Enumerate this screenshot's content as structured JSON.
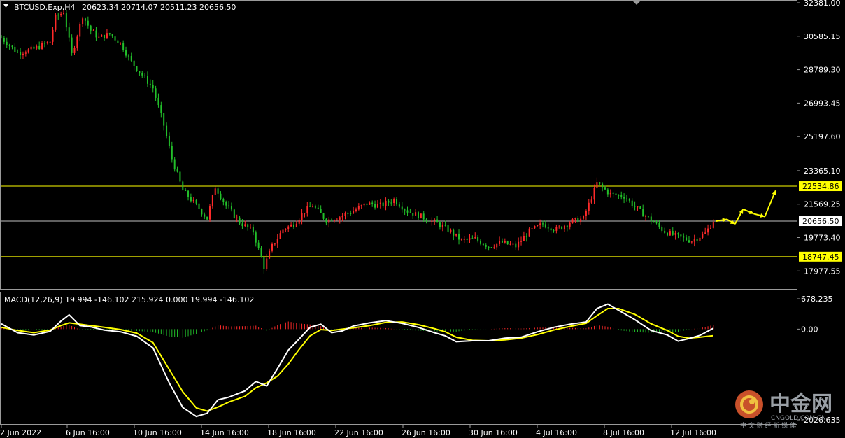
{
  "header": {
    "symbol": "BTCUSD.Exp,H4",
    "ohlc": "20623.34 20714.07 20511.23 20656.50"
  },
  "macd": {
    "label": "MACD(12,26,9) 19.994 -146.102 215.924 0.000 19.994 -146.102",
    "ticks": [
      "678.235",
      "0.00",
      "-2026.635"
    ]
  },
  "watermark": {
    "name": "中金网",
    "domain": "CNGOLD.COM.CN",
    "tagline": "中 文 财 经 新 媒 体"
  },
  "colors": {
    "background": "#000000",
    "bull_candle": "#ff2a2a",
    "bear_candle": "#22c02a",
    "level_line": "#ffff00",
    "current_line": "#c0c0c0",
    "macd_line": "#ffffff",
    "signal_line": "#ffff00",
    "arrow": "#ffff00"
  },
  "chart_data": [
    {
      "type": "candlestick",
      "title": "BTCUSD.Exp,H4",
      "ylim": [
        17200,
        32381
      ],
      "y_ticks": [
        "32381.00",
        "30585.15",
        "28789.30",
        "26993.45",
        "25197.60",
        "23365.10",
        "21569.25",
        "19773.40",
        "17977.55"
      ],
      "x_ticks": [
        "2 Jun 2022",
        "6 Jun 16:00",
        "10 Jun 16:00",
        "14 Jun 16:00",
        "18 Jun 16:00",
        "22 Jun 16:00",
        "26 Jun 16:00",
        "30 Jun 16:00",
        "4 Jul 16:00",
        "8 Jul 16:00",
        "12 Jul 16:00"
      ],
      "levels": [
        {
          "label": "22534.86",
          "value": 22534.86,
          "style": "yellow"
        },
        {
          "label": "20656.50",
          "value": 20656.5,
          "style": "current"
        },
        {
          "label": "18747.45",
          "value": 18747.45,
          "style": "yellow"
        }
      ],
      "price_path": [
        [
          0,
          30500
        ],
        [
          6,
          29700
        ],
        [
          12,
          29900
        ],
        [
          18,
          30300
        ],
        [
          20,
          31600
        ],
        [
          23,
          31900
        ],
        [
          26,
          29600
        ],
        [
          30,
          31700
        ],
        [
          33,
          30900
        ],
        [
          36,
          30500
        ],
        [
          40,
          30700
        ],
        [
          44,
          30200
        ],
        [
          48,
          29200
        ],
        [
          52,
          28500
        ],
        [
          56,
          27800
        ],
        [
          60,
          25800
        ],
        [
          63,
          24000
        ],
        [
          67,
          22300
        ],
        [
          72,
          21500
        ],
        [
          76,
          20800
        ],
        [
          79,
          22500
        ],
        [
          83,
          21500
        ],
        [
          88,
          20600
        ],
        [
          93,
          20100
        ],
        [
          97,
          18200
        ],
        [
          100,
          19300
        ],
        [
          104,
          20200
        ],
        [
          108,
          20500
        ],
        [
          112,
          21200
        ],
        [
          115,
          21500
        ],
        [
          120,
          20700
        ],
        [
          125,
          20900
        ],
        [
          130,
          21200
        ],
        [
          135,
          21600
        ],
        [
          140,
          21500
        ],
        [
          145,
          21800
        ],
        [
          150,
          21200
        ],
        [
          155,
          20900
        ],
        [
          160,
          20600
        ],
        [
          165,
          20200
        ],
        [
          170,
          19600
        ],
        [
          175,
          19700
        ],
        [
          180,
          19300
        ],
        [
          185,
          19500
        ],
        [
          190,
          19300
        ],
        [
          195,
          20100
        ],
        [
          200,
          20500
        ],
        [
          205,
          20200
        ],
        [
          210,
          20600
        ],
        [
          215,
          20800
        ],
        [
          220,
          22700
        ],
        [
          225,
          22100
        ],
        [
          230,
          22000
        ],
        [
          235,
          21300
        ],
        [
          240,
          20700
        ],
        [
          245,
          20100
        ],
        [
          250,
          19800
        ],
        [
          255,
          19600
        ],
        [
          260,
          20000
        ],
        [
          263,
          20656.5
        ]
      ],
      "projection": [
        [
          264,
          20656.5
        ],
        [
          268,
          20750
        ],
        [
          271,
          20500
        ],
        [
          274,
          21300
        ],
        [
          278,
          21050
        ],
        [
          282,
          20900
        ],
        [
          286,
          22300
        ]
      ]
    },
    {
      "type": "line",
      "title": "MACD(12,26,9) 19.994 -146.102 215.924 0.000 19.994 -146.102",
      "ylim": [
        -2026.635,
        678.235
      ],
      "y_ticks": [
        "678.235",
        "0.00",
        "-2026.635"
      ],
      "series": [
        {
          "role": "macd",
          "points": [
            [
              0,
              120
            ],
            [
              6,
              -80
            ],
            [
              12,
              -130
            ],
            [
              18,
              -50
            ],
            [
              22,
              180
            ],
            [
              25,
              320
            ],
            [
              29,
              80
            ],
            [
              33,
              50
            ],
            [
              38,
              -20
            ],
            [
              44,
              -60
            ],
            [
              50,
              -160
            ],
            [
              56,
              -420
            ],
            [
              62,
              -1200
            ],
            [
              67,
              -1750
            ],
            [
              72,
              -1950
            ],
            [
              76,
              -1880
            ],
            [
              80,
              -1580
            ],
            [
              84,
              -1520
            ],
            [
              90,
              -1380
            ],
            [
              94,
              -1170
            ],
            [
              98,
              -1270
            ],
            [
              102,
              -880
            ],
            [
              106,
              -470
            ],
            [
              110,
              -220
            ],
            [
              114,
              40
            ],
            [
              118,
              110
            ],
            [
              122,
              -80
            ],
            [
              126,
              -40
            ],
            [
              130,
              70
            ],
            [
              136,
              140
            ],
            [
              142,
              190
            ],
            [
              148,
              130
            ],
            [
              154,
              40
            ],
            [
              160,
              -80
            ],
            [
              164,
              -150
            ],
            [
              168,
              -280
            ],
            [
              174,
              -260
            ],
            [
              180,
              -260
            ],
            [
              186,
              -200
            ],
            [
              192,
              -180
            ],
            [
              198,
              -60
            ],
            [
              204,
              40
            ],
            [
              210,
              110
            ],
            [
              216,
              160
            ],
            [
              220,
              460
            ],
            [
              224,
              560
            ],
            [
              228,
              420
            ],
            [
              234,
              210
            ],
            [
              240,
              -30
            ],
            [
              246,
              -130
            ],
            [
              250,
              -270
            ],
            [
              254,
              -210
            ],
            [
              258,
              -140
            ],
            [
              263,
              19.994
            ]
          ]
        },
        {
          "role": "signal",
          "points": [
            [
              0,
              40
            ],
            [
              6,
              -30
            ],
            [
              12,
              -80
            ],
            [
              18,
              -20
            ],
            [
              22,
              80
            ],
            [
              25,
              140
            ],
            [
              29,
              110
            ],
            [
              33,
              80
            ],
            [
              38,
              40
            ],
            [
              44,
              -10
            ],
            [
              50,
              -90
            ],
            [
              56,
              -300
            ],
            [
              62,
              -900
            ],
            [
              67,
              -1400
            ],
            [
              72,
              -1760
            ],
            [
              76,
              -1830
            ],
            [
              80,
              -1740
            ],
            [
              84,
              -1630
            ],
            [
              90,
              -1500
            ],
            [
              94,
              -1310
            ],
            [
              98,
              -1200
            ],
            [
              102,
              -1050
            ],
            [
              106,
              -780
            ],
            [
              110,
              -450
            ],
            [
              114,
              -150
            ],
            [
              118,
              -10
            ],
            [
              122,
              -30
            ],
            [
              126,
              0
            ],
            [
              130,
              30
            ],
            [
              136,
              80
            ],
            [
              142,
              150
            ],
            [
              148,
              160
            ],
            [
              154,
              100
            ],
            [
              160,
              10
            ],
            [
              164,
              -60
            ],
            [
              168,
              -180
            ],
            [
              174,
              -250
            ],
            [
              180,
              -260
            ],
            [
              186,
              -240
            ],
            [
              192,
              -200
            ],
            [
              198,
              -120
            ],
            [
              204,
              -20
            ],
            [
              210,
              60
            ],
            [
              216,
              130
            ],
            [
              220,
              300
            ],
            [
              224,
              460
            ],
            [
              228,
              460
            ],
            [
              234,
              330
            ],
            [
              240,
              120
            ],
            [
              246,
              -30
            ],
            [
              250,
              -160
            ],
            [
              254,
              -200
            ],
            [
              258,
              -180
            ],
            [
              263,
              -146.102
            ]
          ]
        }
      ]
    }
  ]
}
